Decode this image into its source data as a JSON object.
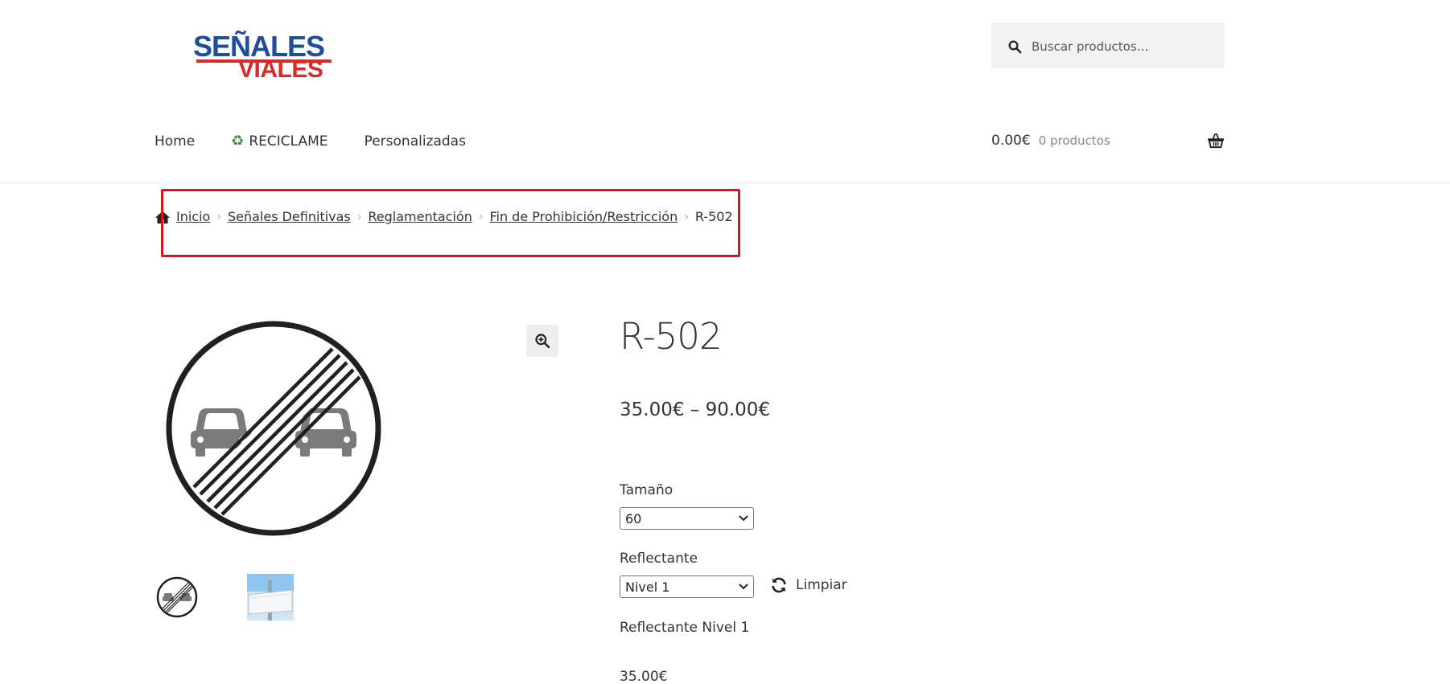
{
  "header": {
    "logo_line1": "SEÑALES",
    "logo_line2": "VIALES",
    "search_placeholder": "Buscar productos…"
  },
  "nav": {
    "items": [
      {
        "label": "Home"
      },
      {
        "label": "RECICLAME"
      },
      {
        "label": "Personalizadas"
      }
    ]
  },
  "cart": {
    "amount": "0.00€",
    "count": "0 productos"
  },
  "breadcrumb": {
    "items": [
      {
        "label": "Inicio"
      },
      {
        "label": "Señales Definitivas"
      },
      {
        "label": "Reglamentación"
      },
      {
        "label": "Fin de Prohibición/Restricción"
      }
    ],
    "current": "R-502",
    "highlight_color": "#e0121b"
  },
  "product": {
    "title": "R-502",
    "price_range": "35.00€ – 90.00€",
    "size_label": "Tamaño",
    "size_value": "60",
    "reflective_label": "Reflectante",
    "reflective_value": "Nivel 1",
    "reset_label": "Limpiar",
    "variation_description": "Reflectante Nivel 1",
    "variation_price": "35.00€"
  },
  "colors": {
    "brand_blue": "#1e4f9c",
    "brand_red": "#d52b2b"
  }
}
